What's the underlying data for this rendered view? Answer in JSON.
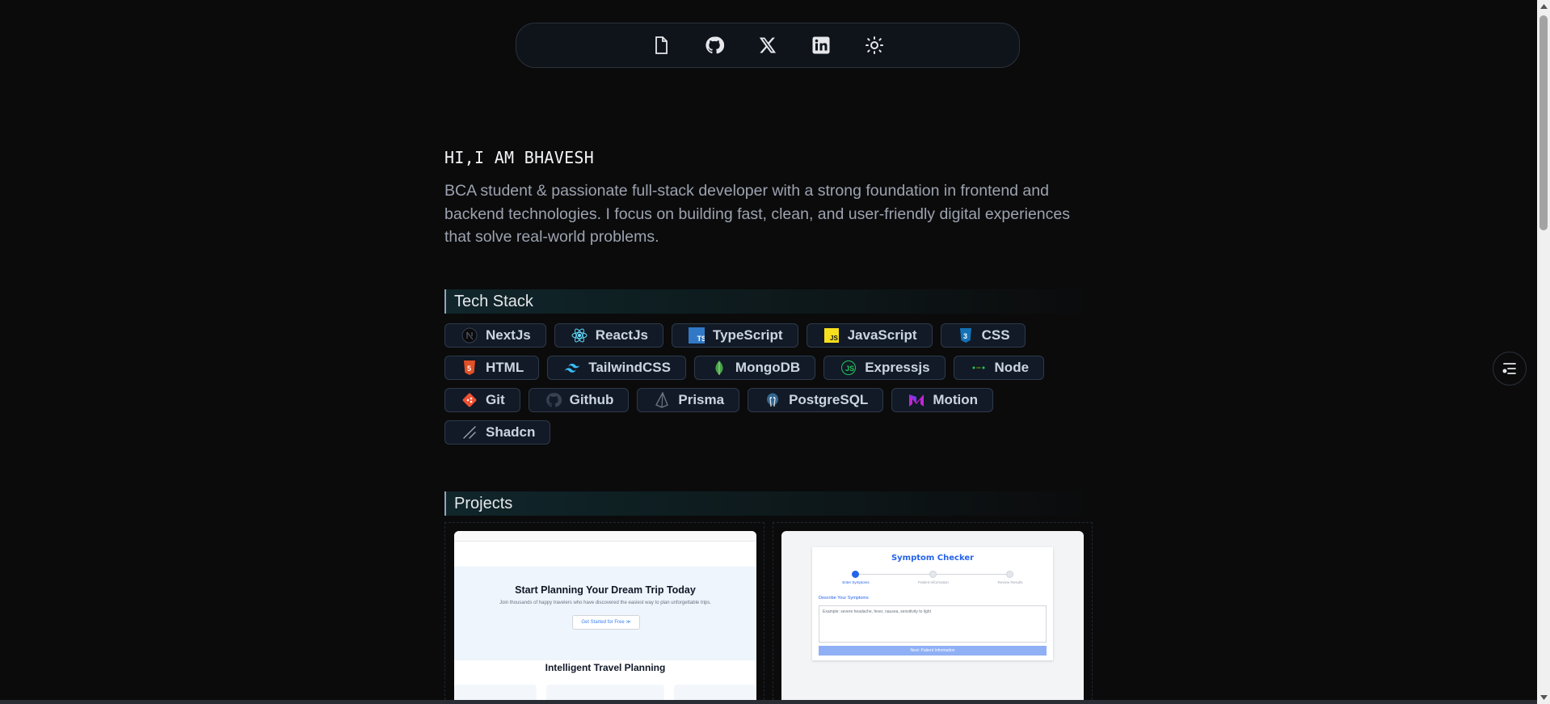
{
  "nav": {
    "icons": [
      "document-icon",
      "github-icon",
      "x-icon",
      "linkedin-icon",
      "sun-icon"
    ]
  },
  "hero": {
    "title": "HI,I AM BHAVESH",
    "description": "BCA student & passionate full-stack developer with a strong foundation in frontend and backend technologies. I focus on building fast, clean, and user-friendly digital experiences that solve real-world problems."
  },
  "tech_stack": {
    "heading": "Tech Stack",
    "items": [
      {
        "label": "NextJs",
        "icon": "nextjs-icon",
        "color": "#1f2937"
      },
      {
        "label": "ReactJs",
        "icon": "react-icon",
        "color": "#61dafb"
      },
      {
        "label": "TypeScript",
        "icon": "typescript-icon",
        "color": "#3178c6"
      },
      {
        "label": "JavaScript",
        "icon": "javascript-icon",
        "color": "#f7df1e"
      },
      {
        "label": "CSS",
        "icon": "css-icon",
        "color": "#1572b6"
      },
      {
        "label": "HTML",
        "icon": "html-icon",
        "color": "#e34f26"
      },
      {
        "label": "TailwindCSS",
        "icon": "tailwind-icon",
        "color": "#38bdf8"
      },
      {
        "label": "MongoDB",
        "icon": "mongodb-icon",
        "color": "#47a248"
      },
      {
        "label": "Expressjs",
        "icon": "express-icon",
        "color": "#22c55e"
      },
      {
        "label": "Node",
        "icon": "node-icon",
        "color": "#22c55e"
      },
      {
        "label": "Git",
        "icon": "git-icon",
        "color": "#f05032"
      },
      {
        "label": "Github",
        "icon": "github-icon",
        "color": "#374151"
      },
      {
        "label": "Prisma",
        "icon": "prisma-icon",
        "color": "#1f2937"
      },
      {
        "label": "PostgreSQL",
        "icon": "postgresql-icon",
        "color": "#336791"
      },
      {
        "label": "Motion",
        "icon": "motion-icon",
        "color": "#c026d3"
      },
      {
        "label": "Shadcn",
        "icon": "shadcn-icon",
        "color": "#9ca3af"
      }
    ]
  },
  "projects": {
    "heading": "Projects",
    "card1": {
      "title": "Start Planning Your Dream Trip Today",
      "subtitle": "Join thousands of happy travelers who have discovered the easiest way to plan unforgettable trips.",
      "button": "Get Started for Free ≫",
      "section_title": "Intelligent Travel Planning"
    },
    "card2": {
      "title": "Symptom Checker",
      "steps": [
        "Enter Symptoms",
        "Patient Information",
        "Review Results"
      ],
      "field_label": "Describe Your Symptoms",
      "placeholder": "Example: severe headache, fever, nausea, sensitivity to light",
      "submit": "Next: Patient Information"
    }
  },
  "colors": {
    "background": "#0b0b0c",
    "chip_bg": "#111a26",
    "chip_border": "#2f3a4a",
    "accent": "#2563eb"
  }
}
